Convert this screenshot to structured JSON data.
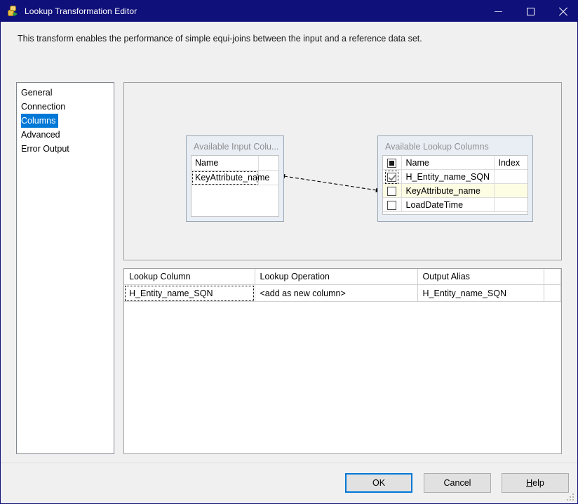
{
  "window": {
    "title": "Lookup Transformation Editor",
    "icon": "lookup-transformation-icon",
    "accent_titlebar": "#10107a",
    "accent_selection": "#0078d7",
    "controls": {
      "minimize": "minimize-icon",
      "maximize": "maximize-icon",
      "close": "close-icon"
    }
  },
  "description": "This transform enables the performance of simple equi-joins between the input and a reference data set.",
  "sidebar": {
    "items": [
      {
        "label": "General",
        "selected": false
      },
      {
        "label": "Connection",
        "selected": false
      },
      {
        "label": "Columns",
        "selected": true
      },
      {
        "label": "Advanced",
        "selected": false
      },
      {
        "label": "Error Output",
        "selected": false
      }
    ]
  },
  "input_columns": {
    "title": "Available Input Colu...",
    "headers": [
      "Name"
    ],
    "rows": [
      {
        "name": "KeyAttribute_name",
        "focused": true
      }
    ]
  },
  "lookup_columns": {
    "title": "Available Lookup Columns",
    "headers": {
      "check": "select-all-checkbox",
      "name": "Name",
      "index": "Index"
    },
    "header_checkbox_state": "indeterminate",
    "rows": [
      {
        "checked": true,
        "focused": true,
        "highlighted": false,
        "name": "H_Entity_name_SQN",
        "index": ""
      },
      {
        "checked": false,
        "focused": false,
        "highlighted": true,
        "name": "KeyAttribute_name",
        "index": ""
      },
      {
        "checked": false,
        "focused": false,
        "highlighted": false,
        "name": "LoadDateTime",
        "index": ""
      }
    ]
  },
  "connector": {
    "style": "dashed-double-arrow",
    "from": "Available Input Columns",
    "to": "Available Lookup Columns"
  },
  "mapping_grid": {
    "headers": [
      "Lookup Column",
      "Lookup Operation",
      "Output Alias",
      ""
    ],
    "rows": [
      {
        "lookup_column": "H_Entity_name_SQN",
        "lookup_operation": "<add as new column>",
        "output_alias": "H_Entity_name_SQN",
        "extra": "",
        "focused": true
      }
    ]
  },
  "footer": {
    "ok": "OK",
    "cancel": "Cancel",
    "help_prefix": "H",
    "help_rest": "elp",
    "help_full": "Help",
    "default_button": "OK"
  }
}
